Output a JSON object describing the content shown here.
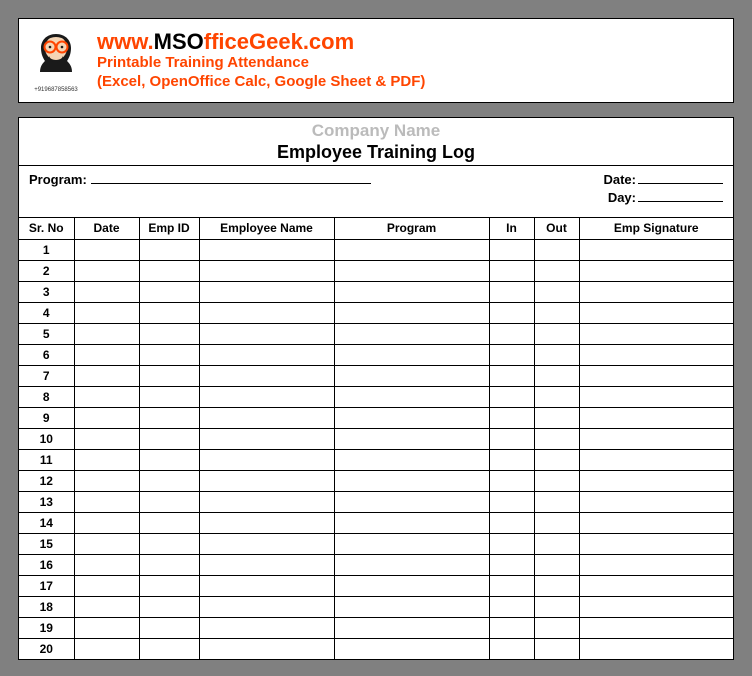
{
  "header": {
    "phone": "+919687858563",
    "site_prefix": "www.",
    "site_ms": "MSO",
    "site_rest": "fficeGeek.com",
    "line2": "Printable Training Attendance",
    "line3": "(Excel, OpenOffice Calc, Google Sheet & PDF)"
  },
  "sheet": {
    "company_name": "Company Name",
    "title": "Employee Training Log",
    "program_label": "Program:",
    "date_label": "Date:",
    "day_label": "Day:"
  },
  "columns": {
    "srno": "Sr. No",
    "date": "Date",
    "empid": "Emp ID",
    "name": "Employee Name",
    "program": "Program",
    "in": "In",
    "out": "Out",
    "sig": "Emp Signature"
  },
  "rows": [
    "1",
    "2",
    "3",
    "4",
    "5",
    "6",
    "7",
    "8",
    "9",
    "10",
    "11",
    "12",
    "13",
    "14",
    "15",
    "16",
    "17",
    "18",
    "19",
    "20"
  ]
}
